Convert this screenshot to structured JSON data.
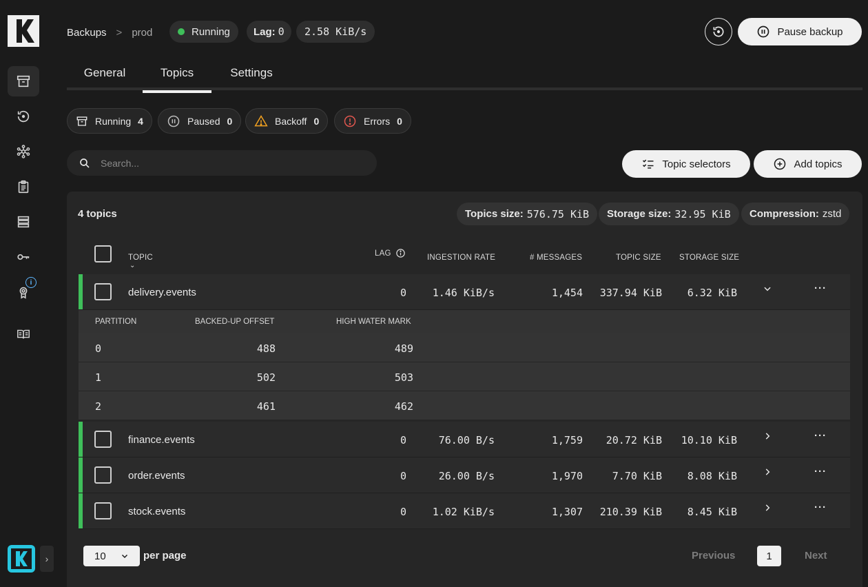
{
  "breadcrumb": {
    "root": "Backups",
    "separator": ">",
    "current": "prod"
  },
  "status_pills": {
    "running": "Running",
    "lag_label": "Lag:",
    "lag_value": "0",
    "rate": "2.58 KiB/s"
  },
  "header": {
    "pause_label": "Pause backup"
  },
  "tabs": [
    {
      "label": "General"
    },
    {
      "label": "Topics"
    },
    {
      "label": "Settings"
    }
  ],
  "filters": [
    {
      "label": "Running",
      "count": "4",
      "icon": "archive-icon"
    },
    {
      "label": "Paused",
      "count": "0",
      "icon": "pause-circle-icon"
    },
    {
      "label": "Backoff",
      "count": "0",
      "icon": "warning-triangle-icon"
    },
    {
      "label": "Errors",
      "count": "0",
      "icon": "error-circle-icon"
    }
  ],
  "search": {
    "placeholder": "Search..."
  },
  "actions": {
    "topic_selectors": "Topic selectors",
    "add_topics": "Add topics"
  },
  "summary": {
    "title": "4 topics",
    "topics_size_label": "Topics size:",
    "topics_size": "576.75 KiB",
    "storage_size_label": "Storage size:",
    "storage_size": "32.95 KiB",
    "compression_label": "Compression:",
    "compression": "zstd"
  },
  "columns": {
    "topic": "TOPIC",
    "lag": "LAG",
    "ingestion_rate": "INGESTION RATE",
    "messages": "# MESSAGES",
    "topic_size": "TOPIC SIZE",
    "storage_size": "STORAGE SIZE"
  },
  "rows": [
    {
      "topic": "delivery.events",
      "lag": "0",
      "rate": "1.46 KiB/s",
      "messages": "1,454",
      "topic_size": "337.94 KiB",
      "storage_size": "6.32 KiB",
      "expanded": true
    },
    {
      "topic": "finance.events",
      "lag": "0",
      "rate": "76.00 B/s",
      "messages": "1,759",
      "topic_size": "20.72 KiB",
      "storage_size": "10.10 KiB",
      "expanded": false
    },
    {
      "topic": "order.events",
      "lag": "0",
      "rate": "26.00 B/s",
      "messages": "1,970",
      "topic_size": "7.70 KiB",
      "storage_size": "8.08 KiB",
      "expanded": false
    },
    {
      "topic": "stock.events",
      "lag": "0",
      "rate": "1.02 KiB/s",
      "messages": "1,307",
      "topic_size": "210.39 KiB",
      "storage_size": "8.45 KiB",
      "expanded": false
    }
  ],
  "partitions": {
    "columns": {
      "partition": "PARTITION",
      "offset": "BACKED-UP OFFSET",
      "hwm": "HIGH WATER MARK"
    },
    "rows": [
      {
        "partition": "0",
        "offset": "488",
        "hwm": "489"
      },
      {
        "partition": "1",
        "offset": "502",
        "hwm": "503"
      },
      {
        "partition": "2",
        "offset": "461",
        "hwm": "462"
      }
    ]
  },
  "pagination": {
    "page_size": "10",
    "per_page_label": "per page",
    "previous": "Previous",
    "current_page": "1",
    "next": "Next"
  },
  "colors": {
    "accent_green": "#3fbf5a",
    "warning": "#f0a020",
    "error": "#e0574f",
    "info": "#5fb7ff",
    "brand_cyan": "#27c6e0"
  }
}
